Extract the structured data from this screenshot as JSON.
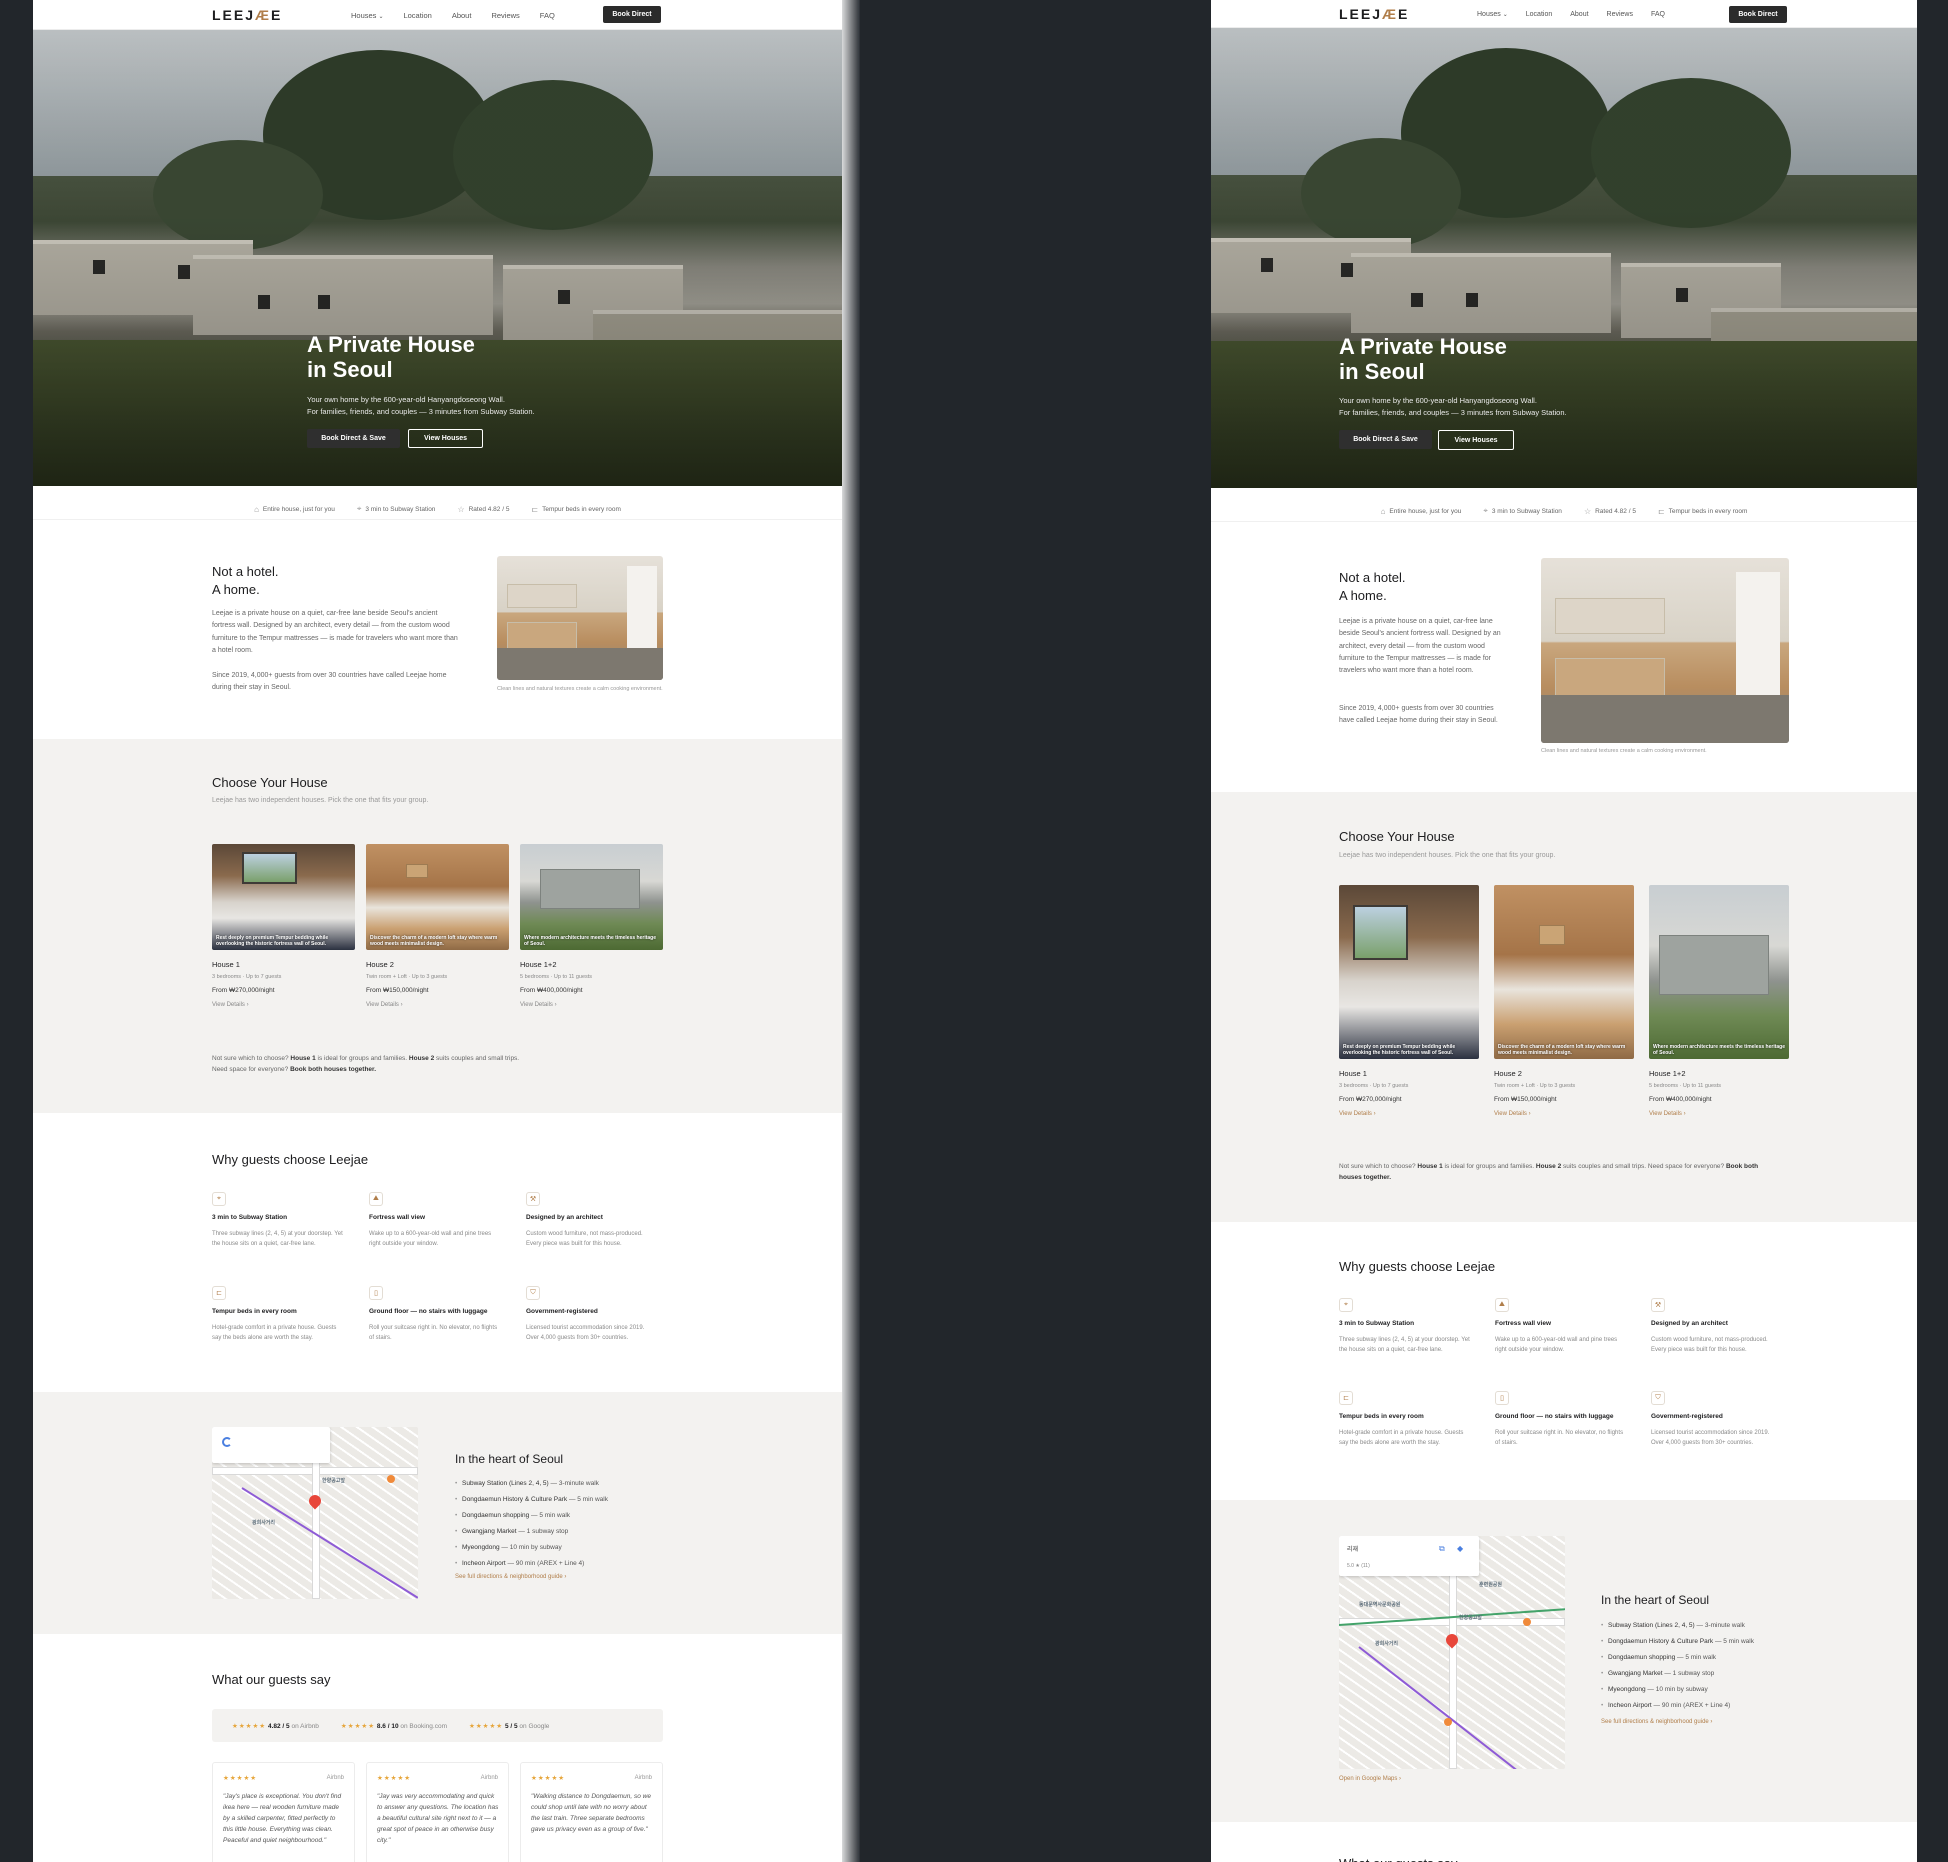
{
  "brand": {
    "logo": "LEEJ",
    "logo_ae": "Æ",
    "logo_end": "E",
    "accent": "#b07e4a"
  },
  "nav": {
    "houses": "Houses",
    "location": "Location",
    "about": "About",
    "reviews": "Reviews",
    "faq": "FAQ",
    "book": "Book Direct"
  },
  "hero": {
    "title_1": "A Private House",
    "title_2": "in Seoul",
    "sub_1": "Your own home by the 600-year-old Hanyangdoseong Wall.",
    "sub_2": "For families, friends, and couples — 3 minutes from Subway Station.",
    "btn_primary": "Book Direct & Save",
    "btn_secondary": "View Houses"
  },
  "features": [
    {
      "icon": "house-icon",
      "label": "Entire house, just for you"
    },
    {
      "icon": "location-pin-icon",
      "label": "3 min to Subway Station"
    },
    {
      "icon": "star-icon",
      "label": "Rated 4.82 / 5"
    },
    {
      "icon": "bed-icon",
      "label": "Tempur beds in every room"
    }
  ],
  "about": {
    "title_1": "Not a hotel.",
    "title_2": "A home.",
    "p1": "Leejae is a private house on a quiet, car-free lane beside Seoul's ancient fortress wall. Designed by an architect, every detail — from the custom wood furniture to the Tempur mattresses — is made for travelers who want more than a hotel room.",
    "p2": "Since 2019, 4,000+ guests from over 30 countries have called Leejae home during their stay in Seoul.",
    "caption": "Clean lines and natural textures create a calm cooking environment."
  },
  "houses": {
    "title": "Choose Your House",
    "sub": "Leejae has two independent houses. Pick the one that fits your group.",
    "link": "View Details",
    "items": [
      {
        "name": "House 1",
        "meta": "3 bedrooms · Up to 7 guests",
        "price": "From ₩270,000/night",
        "overlay": "Rest deeply on premium Tempur bedding while overlooking the historic fortress wall of Seoul."
      },
      {
        "name": "House 2",
        "meta": "Twin room + Loft · Up to 3 guests",
        "price": "From ₩150,000/night",
        "overlay": "Discover the charm of a modern loft stay where warm wood meets minimalist design."
      },
      {
        "name": "House 1+2",
        "meta": "5 bedrooms · Up to 11 guests",
        "price": "From ₩400,000/night",
        "overlay": "Where modern architecture meets the timeless heritage of Seoul."
      }
    ],
    "note_a": "Not sure which to choose? ",
    "note_b": "House 1",
    "note_c": " is ideal for groups and families. ",
    "note_d": "House 2",
    "note_e": " suits couples and small trips. Need space for everyone? ",
    "note_f": "Book both houses together."
  },
  "why": {
    "title": "Why guests choose Leejae",
    "items": [
      {
        "icon": "location-pin-icon",
        "glyph": "⌖",
        "title": "3 min to Subway Station",
        "text": "Three subway lines (2, 4, 5) at your doorstep. Yet the house sits on a quiet, car-free lane."
      },
      {
        "icon": "mountain-icon",
        "glyph": "⛰",
        "title": "Fortress wall view",
        "text": "Wake up to a 600-year-old wall and pine trees right outside your window."
      },
      {
        "icon": "hammer-icon",
        "glyph": "⚒",
        "title": "Designed by an architect",
        "text": "Custom wood furniture, not mass-produced. Every piece was built for this house."
      },
      {
        "icon": "bed-icon",
        "glyph": "⊏",
        "title": "Tempur beds in every room",
        "text": "Hotel-grade comfort in a private house. Guests say the beds alone are worth the stay."
      },
      {
        "icon": "door-icon",
        "glyph": "▯",
        "title": "Ground floor — no stairs with luggage",
        "text": "Roll your suitcase right in. No elevator, no flights of stairs."
      },
      {
        "icon": "shield-check-icon",
        "glyph": "⛉",
        "title": "Government-registered",
        "text": "Licensed tourist accommodation since 2019. Over 4,000 guests from 30+ countries."
      }
    ]
  },
  "location": {
    "title": "In the heart of Seoul",
    "items": [
      {
        "b": "Subway Station (Lines 2, 4, 5)",
        "t": " — 3-minute walk"
      },
      {
        "b": "Dongdaemun History & Culture Park",
        "t": " — 5 min walk"
      },
      {
        "b": "Dongdaemun shopping",
        "t": " — 5 min walk"
      },
      {
        "b": "Gwangjang Market",
        "t": " — 1 subway stop"
      },
      {
        "b": "Myeongdong",
        "t": " — 10 min by subway"
      },
      {
        "b": "Incheon Airport",
        "t": " — 90 min (AREX + Line 4)"
      }
    ],
    "link": "See full directions & neighborhood guide",
    "map_link": "Open in Google Maps",
    "map_card_name": "리재",
    "map_card_rating": "5.0 ★ (11)",
    "map_labels": [
      "훈련원공원",
      "한양공고앞",
      "광희사거리",
      "동대문역사문화공원"
    ]
  },
  "reviews": {
    "title": "What our guests say",
    "ratings": [
      {
        "stars": "★★★★★",
        "score": "4.82 / 5",
        "src": "on Airbnb"
      },
      {
        "stars": "★★★★★",
        "score": "8.6 / 10",
        "src": "on Booking.com"
      },
      {
        "stars": "★★★★★",
        "score": "5 / 5",
        "src": "on Google"
      }
    ],
    "cards": [
      {
        "stars": "★★★★★",
        "src": "Airbnb",
        "text": "\"Jay's place is exceptional. You don't find ikea here — real wooden furniture made by a skilled carpenter, fitted perfectly to this little house. Everything was clean. Peaceful and quiet neighbourhood.\""
      },
      {
        "stars": "★★★★★",
        "src": "Airbnb",
        "text": "\"Jay was very accommodating and quick to answer any questions. The location has a beautiful cultural site right next to it — a great spot of peace in an otherwise busy city.\""
      },
      {
        "stars": "★★★★★",
        "src": "Airbnb",
        "text": "\"Walking distance to Dongdaemun, so we could shop until late with no worry about the last train. Three separate bedrooms gave us privacy even as a group of five.\""
      }
    ]
  }
}
